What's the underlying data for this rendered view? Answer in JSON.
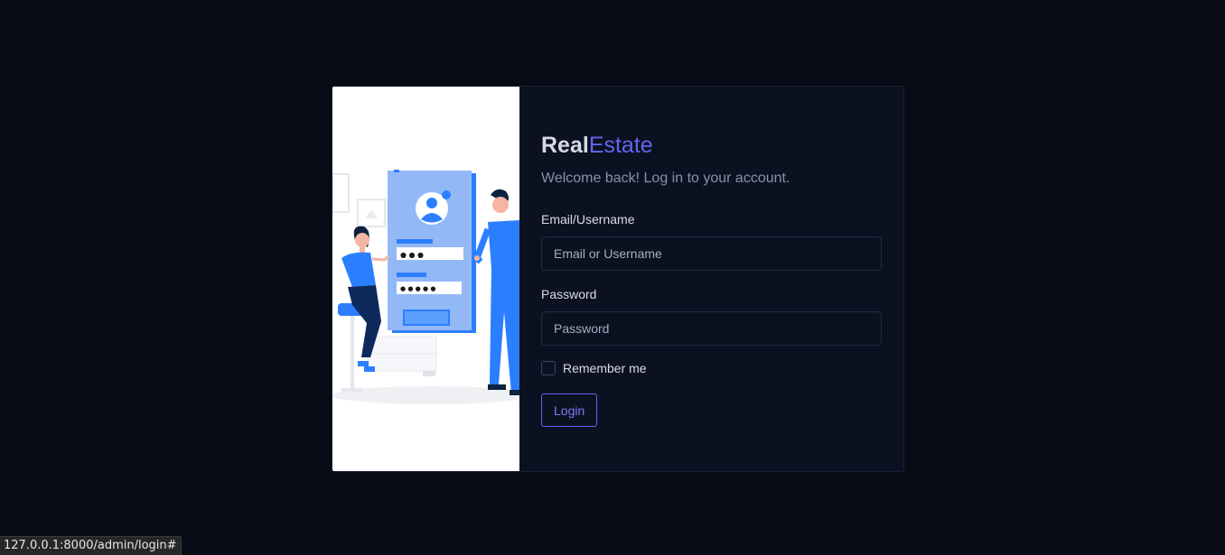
{
  "brand": {
    "part1": "Real",
    "part2": "Estate"
  },
  "subtitle": "Welcome back! Log in to your account.",
  "form": {
    "email_label": "Email/Username",
    "email_placeholder": "Email or Username",
    "email_value": "",
    "password_label": "Password",
    "password_placeholder": "Password",
    "password_value": "",
    "remember_label": "Remember me",
    "remember_checked": false,
    "login_button": "Login"
  },
  "illustration": {
    "password_dots_1": "● ● ●",
    "password_dots_2": "● ● ● ● ●"
  },
  "status_bar": {
    "url": "127.0.0.1:8000/admin/login#"
  },
  "colors": {
    "background": "#070b16",
    "accent": "#6366f1",
    "panel": "#0b1120",
    "illustration_blue": "#2b7fff"
  },
  "icons": [
    "user-avatar-icon",
    "checkbox-icon"
  ]
}
